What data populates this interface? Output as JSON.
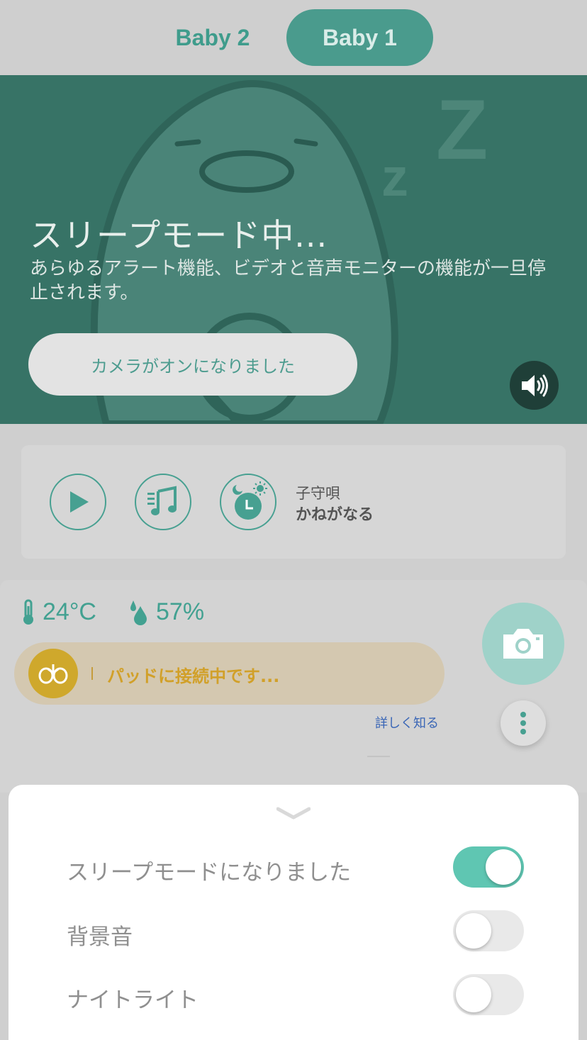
{
  "tabs": [
    {
      "label": "Baby 2",
      "selected": false
    },
    {
      "label": "Baby 1",
      "selected": true
    }
  ],
  "hero": {
    "title": "スリープモード中...",
    "description": "あらゆるアラート機能、ビデオと音声モニターの機能が一旦停止されます。",
    "camera_button": "カメラがオンになりました",
    "speaker_icon": "speaker-icon"
  },
  "media": {
    "play_icon": "play-icon",
    "music_icon": "music-note-icon",
    "timer_icon": "day-night-clock-icon",
    "lullaby_label": "子守唄",
    "lullaby_value": "かねがなる"
  },
  "status": {
    "temperature": "24°C",
    "humidity": "57%",
    "pad_status": "パッドに接続中です...",
    "learn_more": "詳しく知る",
    "camera_icon": "camera-icon",
    "more_icon": "more-vertical-icon"
  },
  "sheet": {
    "rows": [
      {
        "label": "スリープモードになりました",
        "on": true
      },
      {
        "label": "背景音",
        "on": false
      },
      {
        "label": "ナイトライト",
        "on": false
      }
    ]
  },
  "colors": {
    "accent": "#47a091",
    "hero_bg": "#377366",
    "pad_warning": "#d1a029",
    "toggle_on": "#5fc6b2"
  }
}
